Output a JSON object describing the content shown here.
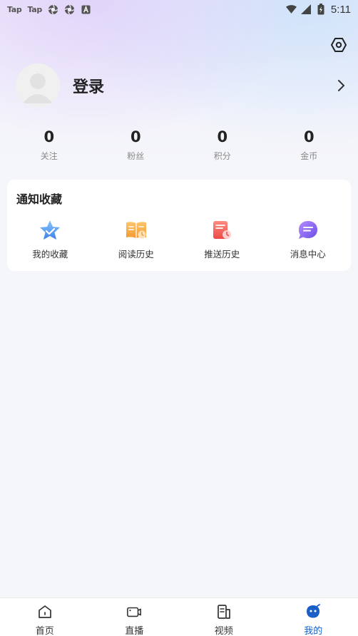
{
  "status_bar": {
    "left_items": [
      "Tap",
      "Tap"
    ],
    "time": "5:11",
    "icons": [
      "tap-icon",
      "tap-icon",
      "aperture-icon",
      "aperture-icon",
      "a-icon",
      "wifi-icon",
      "signal-icon",
      "battery-icon"
    ]
  },
  "profile": {
    "login_label": "登录"
  },
  "stats": [
    {
      "value": "0",
      "label": "关注"
    },
    {
      "value": "0",
      "label": "粉丝"
    },
    {
      "value": "0",
      "label": "积分"
    },
    {
      "value": "0",
      "label": "金币"
    }
  ],
  "notice_card": {
    "title": "通知收藏",
    "items": [
      {
        "label": "我的收藏",
        "icon": "star-icon"
      },
      {
        "label": "阅读历史",
        "icon": "book-icon"
      },
      {
        "label": "推送历史",
        "icon": "push-history-icon"
      },
      {
        "label": "消息中心",
        "icon": "message-icon"
      }
    ]
  },
  "tabbar": {
    "active": "我的",
    "tabs": [
      {
        "label": "首页",
        "icon": "home-icon"
      },
      {
        "label": "直播",
        "icon": "live-icon"
      },
      {
        "label": "视频",
        "icon": "video-icon"
      },
      {
        "label": "我的",
        "icon": "profile-icon"
      }
    ]
  },
  "colors": {
    "accent": "#1a5fc7",
    "background": "#f5f6f9",
    "card": "#ffffff"
  }
}
